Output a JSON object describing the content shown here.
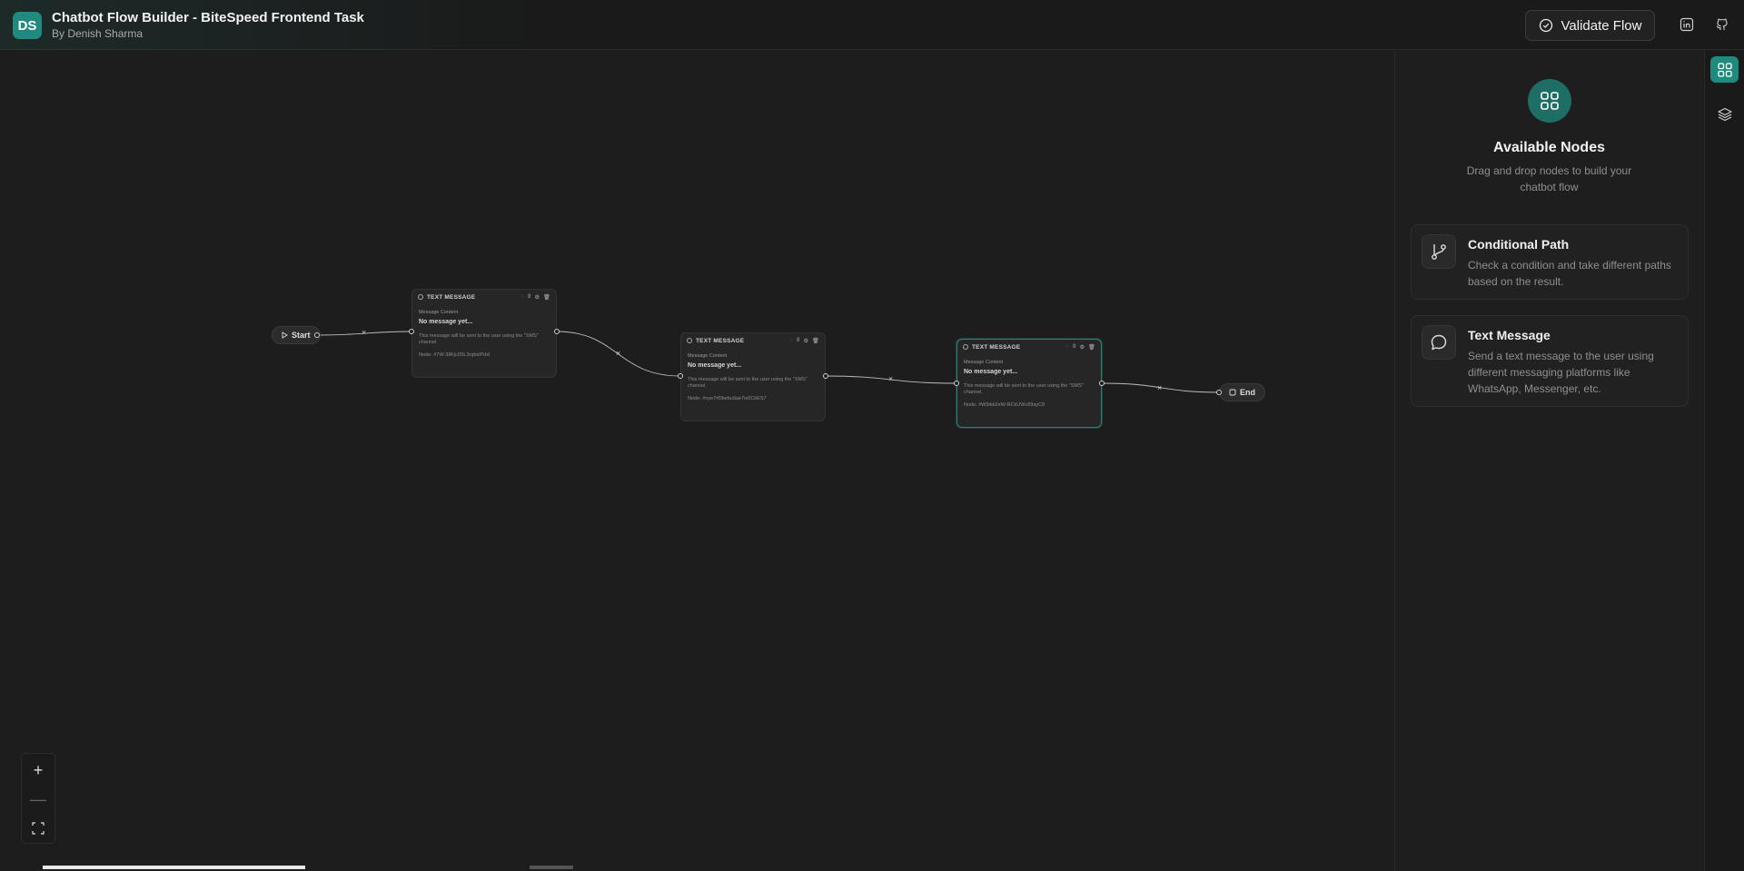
{
  "header": {
    "logo_initials": "DS",
    "title": "Chatbot Flow Builder - BiteSpeed Frontend Task",
    "subtitle": "By Denish Sharma",
    "validate_label": "Validate Flow"
  },
  "flow": {
    "start_label": "Start",
    "end_label": "End",
    "nodes": [
      {
        "type": "TEXT MESSAGE",
        "count": "0",
        "content_label": "Message Content",
        "message": "No message yet...",
        "note": "This message will be sent to the user using the \"SMS\" channel.",
        "id_label": "Node:",
        "id": "#7W-38Fjc0SL3rqbxlPdxl"
      },
      {
        "type": "TEXT MESSAGE",
        "count": "0",
        "content_label": "Message Content",
        "message": "No message yet...",
        "note": "This message will be sent to the user using the \"SMS\" channel.",
        "id_label": "Node:",
        "id": "#oye7rf0bebu9ae7ie0CkES7"
      },
      {
        "type": "TEXT MESSAGE",
        "count": "0",
        "content_label": "Message Content",
        "message": "No message yet...",
        "note": "This message will be sent to the user using the \"SMS\" channel.",
        "id_label": "Node:",
        "id": "#W9ikb2eW-RCkUWc89ayC8"
      }
    ]
  },
  "panel": {
    "title": "Available Nodes",
    "description": "Drag and drop nodes to build your chatbot flow",
    "cards": [
      {
        "icon": "branch-icon",
        "title": "Conditional Path",
        "description": "Check a condition and take different paths based on the result."
      },
      {
        "icon": "chat-bubble-icon",
        "title": "Text Message",
        "description": "Send a text message to the user using different messaging platforms like WhatsApp, Messenger, etc."
      }
    ]
  },
  "colors": {
    "accent": "#1f8a7d",
    "background": "#1d1d1d",
    "selected_border": "#2f7f76"
  }
}
